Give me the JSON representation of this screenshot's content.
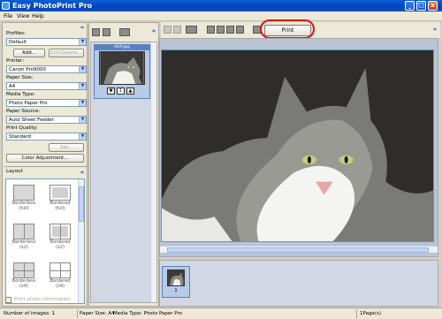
{
  "app": {
    "title": "Easy PhotoPrint Pro"
  },
  "window_buttons": {
    "minimize": "_",
    "maximize": "□",
    "close": "x"
  },
  "menu": {
    "items": [
      "File",
      "View",
      "Help"
    ]
  },
  "settings": {
    "profiles_label": "Profiles:",
    "profiles_value": "Default",
    "add_label": "Add...",
    "edit_delete_label": "Edit/Delete...",
    "printer_label": "Printer:",
    "printer_value": "Canon Pro9000",
    "paper_size_label": "Paper Size:",
    "paper_size_value": "A4",
    "media_type_label": "Media Type:",
    "media_type_value": "Photo Paper Pro",
    "paper_source_label": "Paper Source:",
    "paper_source_value": "Auto Sheet Feeder",
    "print_quality_label": "Print Quality:",
    "print_quality_value": "Standard",
    "set_label": "Set...",
    "color_adjustment_label": "Color Adjustment...",
    "layout_label": "Layout",
    "layouts": [
      {
        "label1": "Borderless",
        "label2": "(full)",
        "style": "full"
      },
      {
        "label1": "Bordered",
        "label2": "(full)",
        "style": "bordered"
      },
      {
        "label1": "Borderless",
        "label2": "(x2)",
        "style": "split2"
      },
      {
        "label1": "Bordered",
        "label2": "(x2)",
        "style": "bordered-split2"
      },
      {
        "label1": "Borderless",
        "label2": "(x4)",
        "style": "split4"
      },
      {
        "label1": "Bordered",
        "label2": "(x4)",
        "style": "bordered-split4"
      }
    ],
    "print_photo_info_label": "Print photo information"
  },
  "thumbnails": {
    "selected_filename": "AAA.jpg",
    "copies": "1"
  },
  "toolbar": {
    "print_label": "Print"
  },
  "filmstrip": {
    "item_number": "1"
  },
  "status": {
    "number_of_images": "Number of images: 1",
    "paper_size": "Paper Size: A4",
    "media_type": "Media Type: Photo Paper Pro",
    "pages": "1Page(s)"
  },
  "colors": {
    "titlebar": "#0a4fc8",
    "highlight_circle": "#e01010",
    "preview_border": "#3aa0e0"
  }
}
